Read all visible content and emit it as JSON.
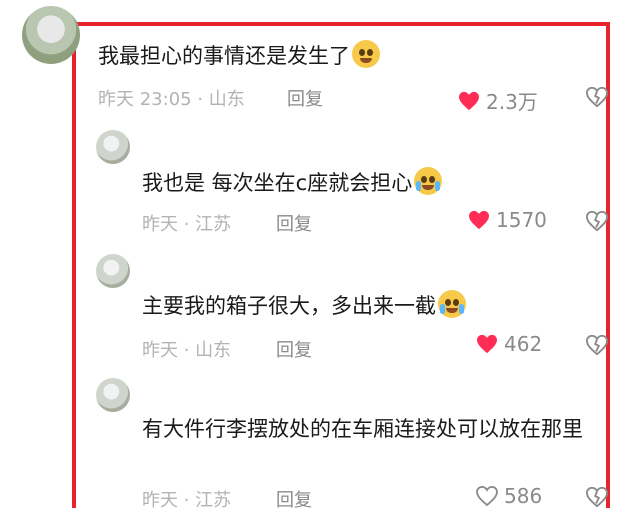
{
  "comments": [
    {
      "text": "我最担心的事情还是发生了",
      "meta": "昨天 23:05 · 山东",
      "reply": "回复",
      "likes": "2.3万",
      "liked": true
    },
    {
      "text": "我也是 每次坐在c座就会担心",
      "meta": "昨天 · 江苏",
      "reply": "回复",
      "likes": "1570",
      "liked": true
    },
    {
      "text": "主要我的箱子很大，多出来一截",
      "meta": "昨天 · 山东",
      "reply": "回复",
      "likes": "462",
      "liked": true
    },
    {
      "text": "有大件行李摆放处的在车厢连接处可以放在那里",
      "meta": "昨天 · 江苏",
      "reply": "回复",
      "likes": "586",
      "liked": false
    }
  ],
  "colors": {
    "highlight_border": "#e8232b",
    "like_red": "#ff2d55",
    "meta_gray": "#b3b3b3"
  },
  "icons": [
    "heart-icon",
    "dislike-icon",
    "emoji-pleading",
    "emoji-laugh-cry",
    "emoji-cry"
  ]
}
